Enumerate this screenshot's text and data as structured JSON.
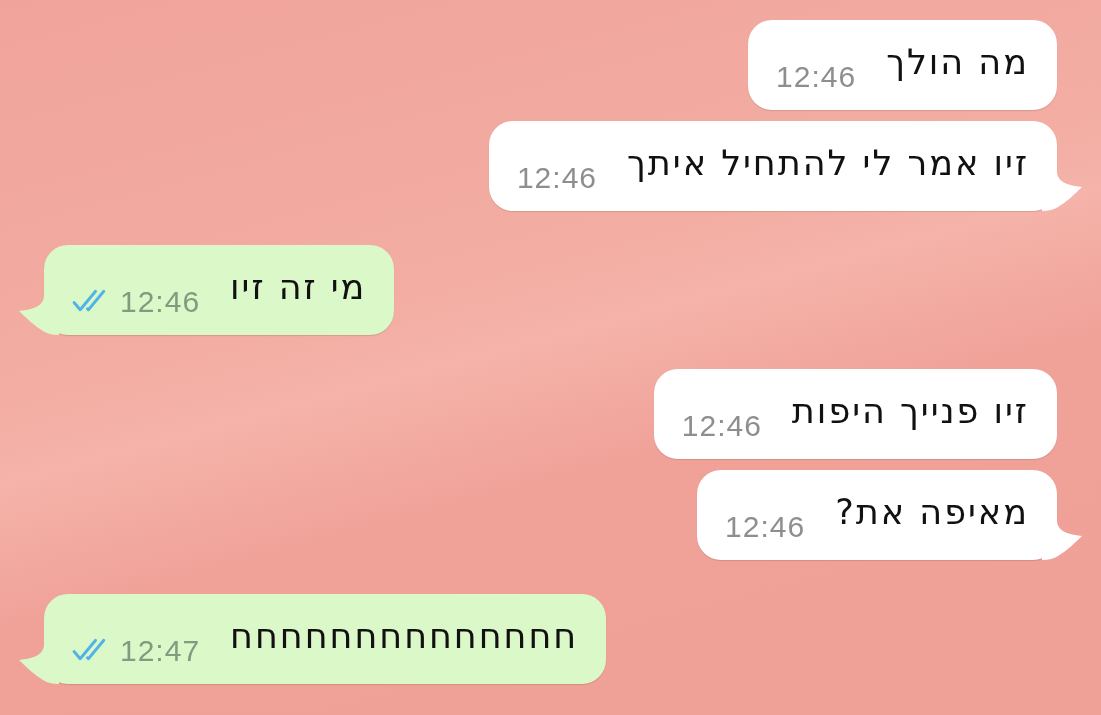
{
  "messages": [
    {
      "kind": "incoming",
      "text": "מה הולך",
      "time": "12:46"
    },
    {
      "kind": "incoming",
      "text": "זיו אמר לי להתחיל איתך",
      "time": "12:46"
    },
    {
      "kind": "outgoing",
      "text": "מי זה זיו",
      "time": "12:46",
      "read": true
    },
    {
      "kind": "incoming",
      "text": "זיו פנייך היפות",
      "time": "12:46"
    },
    {
      "kind": "incoming",
      "text": "מאיפה את?",
      "time": "12:46"
    },
    {
      "kind": "outgoing",
      "text": "חחחחחחחחחחחחחח",
      "time": "12:47",
      "read": true
    }
  ]
}
